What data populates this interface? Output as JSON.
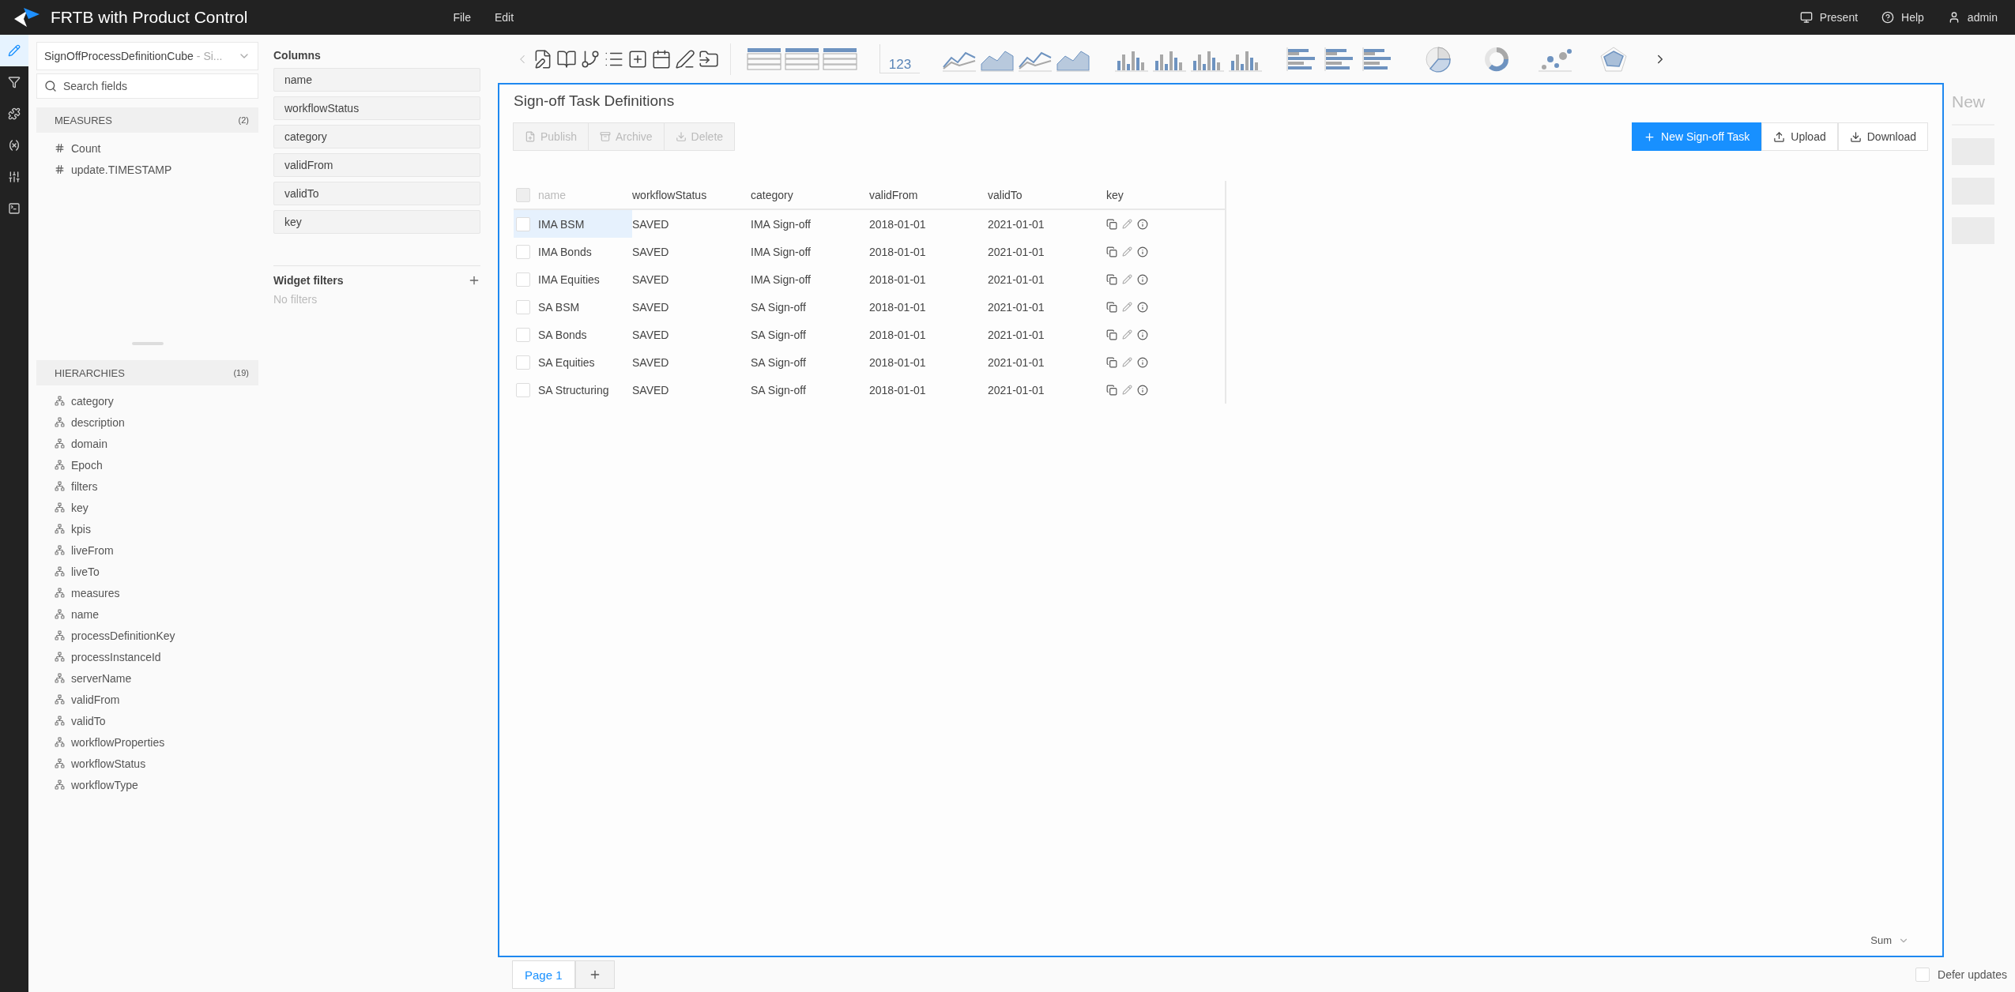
{
  "app": {
    "title": "FRTB with Product Control"
  },
  "menu": [
    "File",
    "Edit"
  ],
  "header_actions": [
    {
      "kind": "present",
      "label": "Present"
    },
    {
      "kind": "help",
      "label": "Help"
    },
    {
      "kind": "user",
      "label": "admin"
    }
  ],
  "rail": [
    {
      "kind": "edit",
      "selected": true
    },
    {
      "kind": "filter",
      "selected": false
    },
    {
      "kind": "puzzle",
      "selected": false
    },
    {
      "kind": "variable",
      "selected": false
    },
    {
      "kind": "sliders",
      "selected": false
    },
    {
      "kind": "terminal",
      "selected": false
    }
  ],
  "data_panel": {
    "cube_name": "SignOffProcessDefinitionCube",
    "cube_suffix": "- Si...",
    "search_placeholder": "Search fields",
    "measures": {
      "title": "MEASURES",
      "count": "(2)",
      "items": [
        "Count",
        "update.TIMESTAMP"
      ]
    },
    "hierarchies": {
      "title": "HIERARCHIES",
      "count": "(19)",
      "items": [
        "category",
        "description",
        "domain",
        "Epoch",
        "filters",
        "key",
        "kpis",
        "liveFrom",
        "liveTo",
        "measures",
        "name",
        "processDefinitionKey",
        "processInstanceId",
        "serverName",
        "validFrom",
        "validTo",
        "workflowProperties",
        "workflowStatus",
        "workflowType"
      ]
    }
  },
  "columns_panel": {
    "title": "Columns",
    "fields": [
      "name",
      "workflowStatus",
      "category",
      "validFrom",
      "validTo",
      "key"
    ],
    "filters_title": "Widget filters",
    "filters_empty": "No filters"
  },
  "toolbar": {
    "nav": [
      {
        "kind": "back"
      },
      {
        "kind": "page-edit"
      },
      {
        "kind": "book"
      },
      {
        "kind": "branch"
      },
      {
        "kind": "list"
      },
      {
        "kind": "add-widget"
      },
      {
        "kind": "calendar"
      },
      {
        "kind": "pen"
      },
      {
        "kind": "move"
      }
    ],
    "widgets": [
      {
        "kind": "table"
      },
      {
        "kind": "table"
      },
      {
        "kind": "table"
      },
      {
        "kind": "kpi",
        "label": "123"
      },
      {
        "kind": "line"
      },
      {
        "kind": "area"
      },
      {
        "kind": "line"
      },
      {
        "kind": "area"
      },
      {
        "kind": "column"
      },
      {
        "kind": "column"
      },
      {
        "kind": "column"
      },
      {
        "kind": "column"
      },
      {
        "kind": "bar"
      },
      {
        "kind": "bar"
      },
      {
        "kind": "bar"
      },
      {
        "kind": "pie"
      },
      {
        "kind": "donut"
      },
      {
        "kind": "scatter"
      },
      {
        "kind": "radar"
      }
    ]
  },
  "widget": {
    "title": "Sign-off Task Definitions",
    "actions": [
      {
        "kind": "publish",
        "label": "Publish",
        "disabled": true
      },
      {
        "kind": "archive",
        "label": "Archive",
        "disabled": true
      },
      {
        "kind": "delete",
        "label": "Delete",
        "disabled": true
      }
    ],
    "tools": [
      {
        "kind": "new",
        "label": "New Sign-off Task",
        "primary": true
      },
      {
        "kind": "upload",
        "label": "Upload",
        "primary": false
      },
      {
        "kind": "download",
        "label": "Download",
        "primary": false
      }
    ],
    "table": {
      "select_all_disabled": true,
      "columns": [
        "name",
        "workflowStatus",
        "category",
        "validFrom",
        "validTo",
        "key"
      ],
      "rows": [
        {
          "cells": [
            "IMA BSM",
            "SAVED",
            "IMA Sign-off",
            "2018-01-01",
            "2021-01-01"
          ],
          "checked": false,
          "selected": true
        },
        {
          "cells": [
            "IMA Bonds",
            "SAVED",
            "IMA Sign-off",
            "2018-01-01",
            "2021-01-01"
          ],
          "checked": false,
          "selected": false
        },
        {
          "cells": [
            "IMA Equities",
            "SAVED",
            "IMA Sign-off",
            "2018-01-01",
            "2021-01-01"
          ],
          "checked": false,
          "selected": false
        },
        {
          "cells": [
            "SA BSM",
            "SAVED",
            "SA Sign-off",
            "2018-01-01",
            "2021-01-01"
          ],
          "checked": false,
          "selected": false
        },
        {
          "cells": [
            "SA Bonds",
            "SAVED",
            "SA Sign-off",
            "2018-01-01",
            "2021-01-01"
          ],
          "checked": false,
          "selected": false
        },
        {
          "cells": [
            "SA Equities",
            "SAVED",
            "SA Sign-off",
            "2018-01-01",
            "2021-01-01"
          ],
          "checked": false,
          "selected": false
        },
        {
          "cells": [
            "SA Structuring",
            "SAVED",
            "SA Sign-off",
            "2018-01-01",
            "2021-01-01"
          ],
          "checked": false,
          "selected": false
        }
      ]
    },
    "aggregation": "Sum"
  },
  "side_strip": {
    "label": "New"
  },
  "pages": [
    {
      "label": "Page 1",
      "selected": true
    }
  ],
  "defer_updates": {
    "label": "Defer updates",
    "checked": false
  }
}
